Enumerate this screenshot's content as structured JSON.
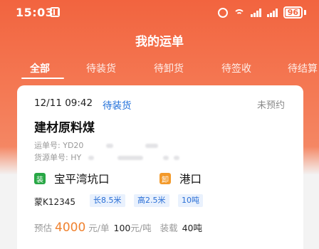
{
  "status_bar": {
    "time": "15:03",
    "battery": "96",
    "battery_level": 0.96
  },
  "header": {
    "title": "我的运单"
  },
  "tabs": [
    {
      "label": "全部",
      "active": true
    },
    {
      "label": "待装货",
      "active": false
    },
    {
      "label": "待卸货",
      "active": false
    },
    {
      "label": "待签收",
      "active": false
    },
    {
      "label": "待结算",
      "active": false
    }
  ],
  "order": {
    "datetime": "12/11 09:42",
    "status": "待装货",
    "appointment": "未预约",
    "cargo": "建材原料煤",
    "waybill_label": "运单号:",
    "waybill_value": "YD20",
    "source_label": "货源单号:",
    "source_value": "HY",
    "origin_badge": "装",
    "origin": "宝平湾坑口",
    "dest_badge": "卸",
    "dest": "港口",
    "plate": "蒙K12345",
    "specs": [
      "长8.5米",
      "高2.5米",
      "10吨"
    ],
    "estimate_label": "预估",
    "price": "4000",
    "price_unit": "元/单",
    "unit_price": "100",
    "unit_price_unit": "元/吨",
    "load_label": "装载",
    "load_value": "40吨"
  },
  "colors": {
    "accent": "#f2643f",
    "link": "#1f6fd9",
    "price": "#f0822f",
    "load_badge": "#28a745",
    "unload_badge": "#f39a2b"
  }
}
